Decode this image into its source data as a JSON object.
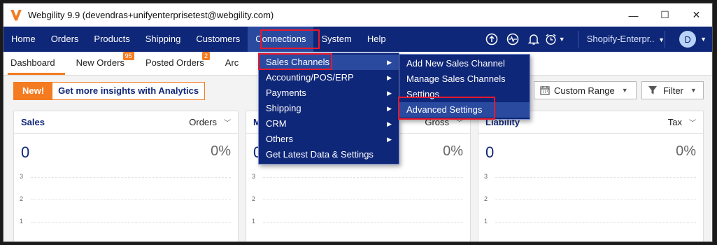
{
  "window": {
    "title": "Webgility 9.9 (devendras+unifyenterprisetest@webgility.com)",
    "controls": [
      "—",
      "☐",
      "✕"
    ]
  },
  "nav": {
    "items": [
      "Home",
      "Orders",
      "Products",
      "Shipping",
      "Customers",
      "Connections",
      "System",
      "Help"
    ],
    "store": "Shopify-Enterpr..",
    "avatar": "D",
    "icons": [
      "upload-icon",
      "activity-icon",
      "bell-icon",
      "clock-icon"
    ]
  },
  "tabs": {
    "items": [
      {
        "label": "Dashboard",
        "badge": ""
      },
      {
        "label": "New Orders",
        "badge": "95"
      },
      {
        "label": "Posted Orders",
        "badge": "2"
      },
      {
        "label": "Arc",
        "badge": ""
      }
    ]
  },
  "actions": {
    "promo_new": "New!",
    "promo_text": "Get more insights with Analytics",
    "range_label": "Custom Range",
    "filter_label": "Filter"
  },
  "cards": [
    {
      "title": "Sales",
      "metric": "Orders",
      "value": "0",
      "pct": "0%"
    },
    {
      "title": "M",
      "metric": "Gross",
      "value": "0",
      "pct": "0%"
    },
    {
      "title": "Liability",
      "metric": "Tax",
      "value": "0",
      "pct": "0%"
    }
  ],
  "chart_ticks": [
    "3",
    "2",
    "1"
  ],
  "connections_menu": {
    "items": [
      "Sales Channels",
      "Accounting/POS/ERP",
      "Payments",
      "Shipping",
      "CRM",
      "Others",
      "Get Latest Data & Settings"
    ]
  },
  "sales_channels_menu": {
    "items": [
      "Add New Sales Channel",
      "Manage Sales Channels",
      "Settings",
      "Advanced Settings"
    ]
  },
  "colors": {
    "brand_navy": "#0f2778",
    "accent_orange": "#f47b20",
    "highlight_red": "#e8192c"
  }
}
